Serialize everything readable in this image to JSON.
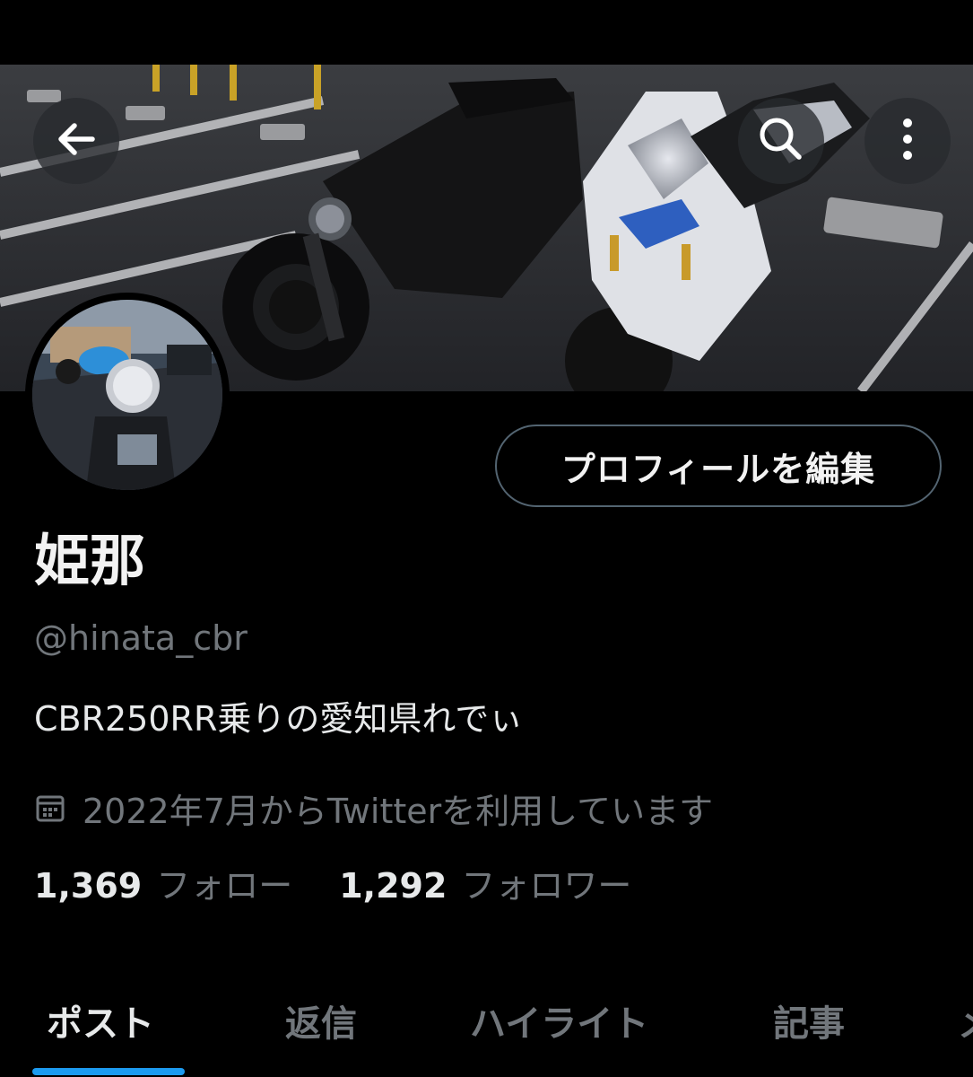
{
  "header": {
    "back_icon": "arrow-left-icon",
    "search_icon": "search-icon",
    "more_icon": "more-vertical-icon"
  },
  "profile": {
    "edit_button_label": "プロフィールを編集",
    "display_name": "姫那",
    "handle": "@hinata_cbr",
    "bio": "CBR250RR乗りの愛知県れでぃ",
    "joined_icon": "calendar-icon",
    "joined_text": "2022年7月からTwitterを利用しています"
  },
  "stats": {
    "following_count": "1,369",
    "following_label": "フォロー",
    "followers_count": "1,292",
    "followers_label": "フォロワー"
  },
  "tabs": [
    {
      "label": "ポスト",
      "active": true
    },
    {
      "label": "返信",
      "active": false
    },
    {
      "label": "ハイライト",
      "active": false
    },
    {
      "label": "記事",
      "active": false
    },
    {
      "label": "メ",
      "active": false
    }
  ],
  "colors": {
    "background": "#000000",
    "accent": "#1d9bf0",
    "secondary_text": "#71767b",
    "primary_text": "#e7e9ea",
    "button_border": "#536471"
  }
}
